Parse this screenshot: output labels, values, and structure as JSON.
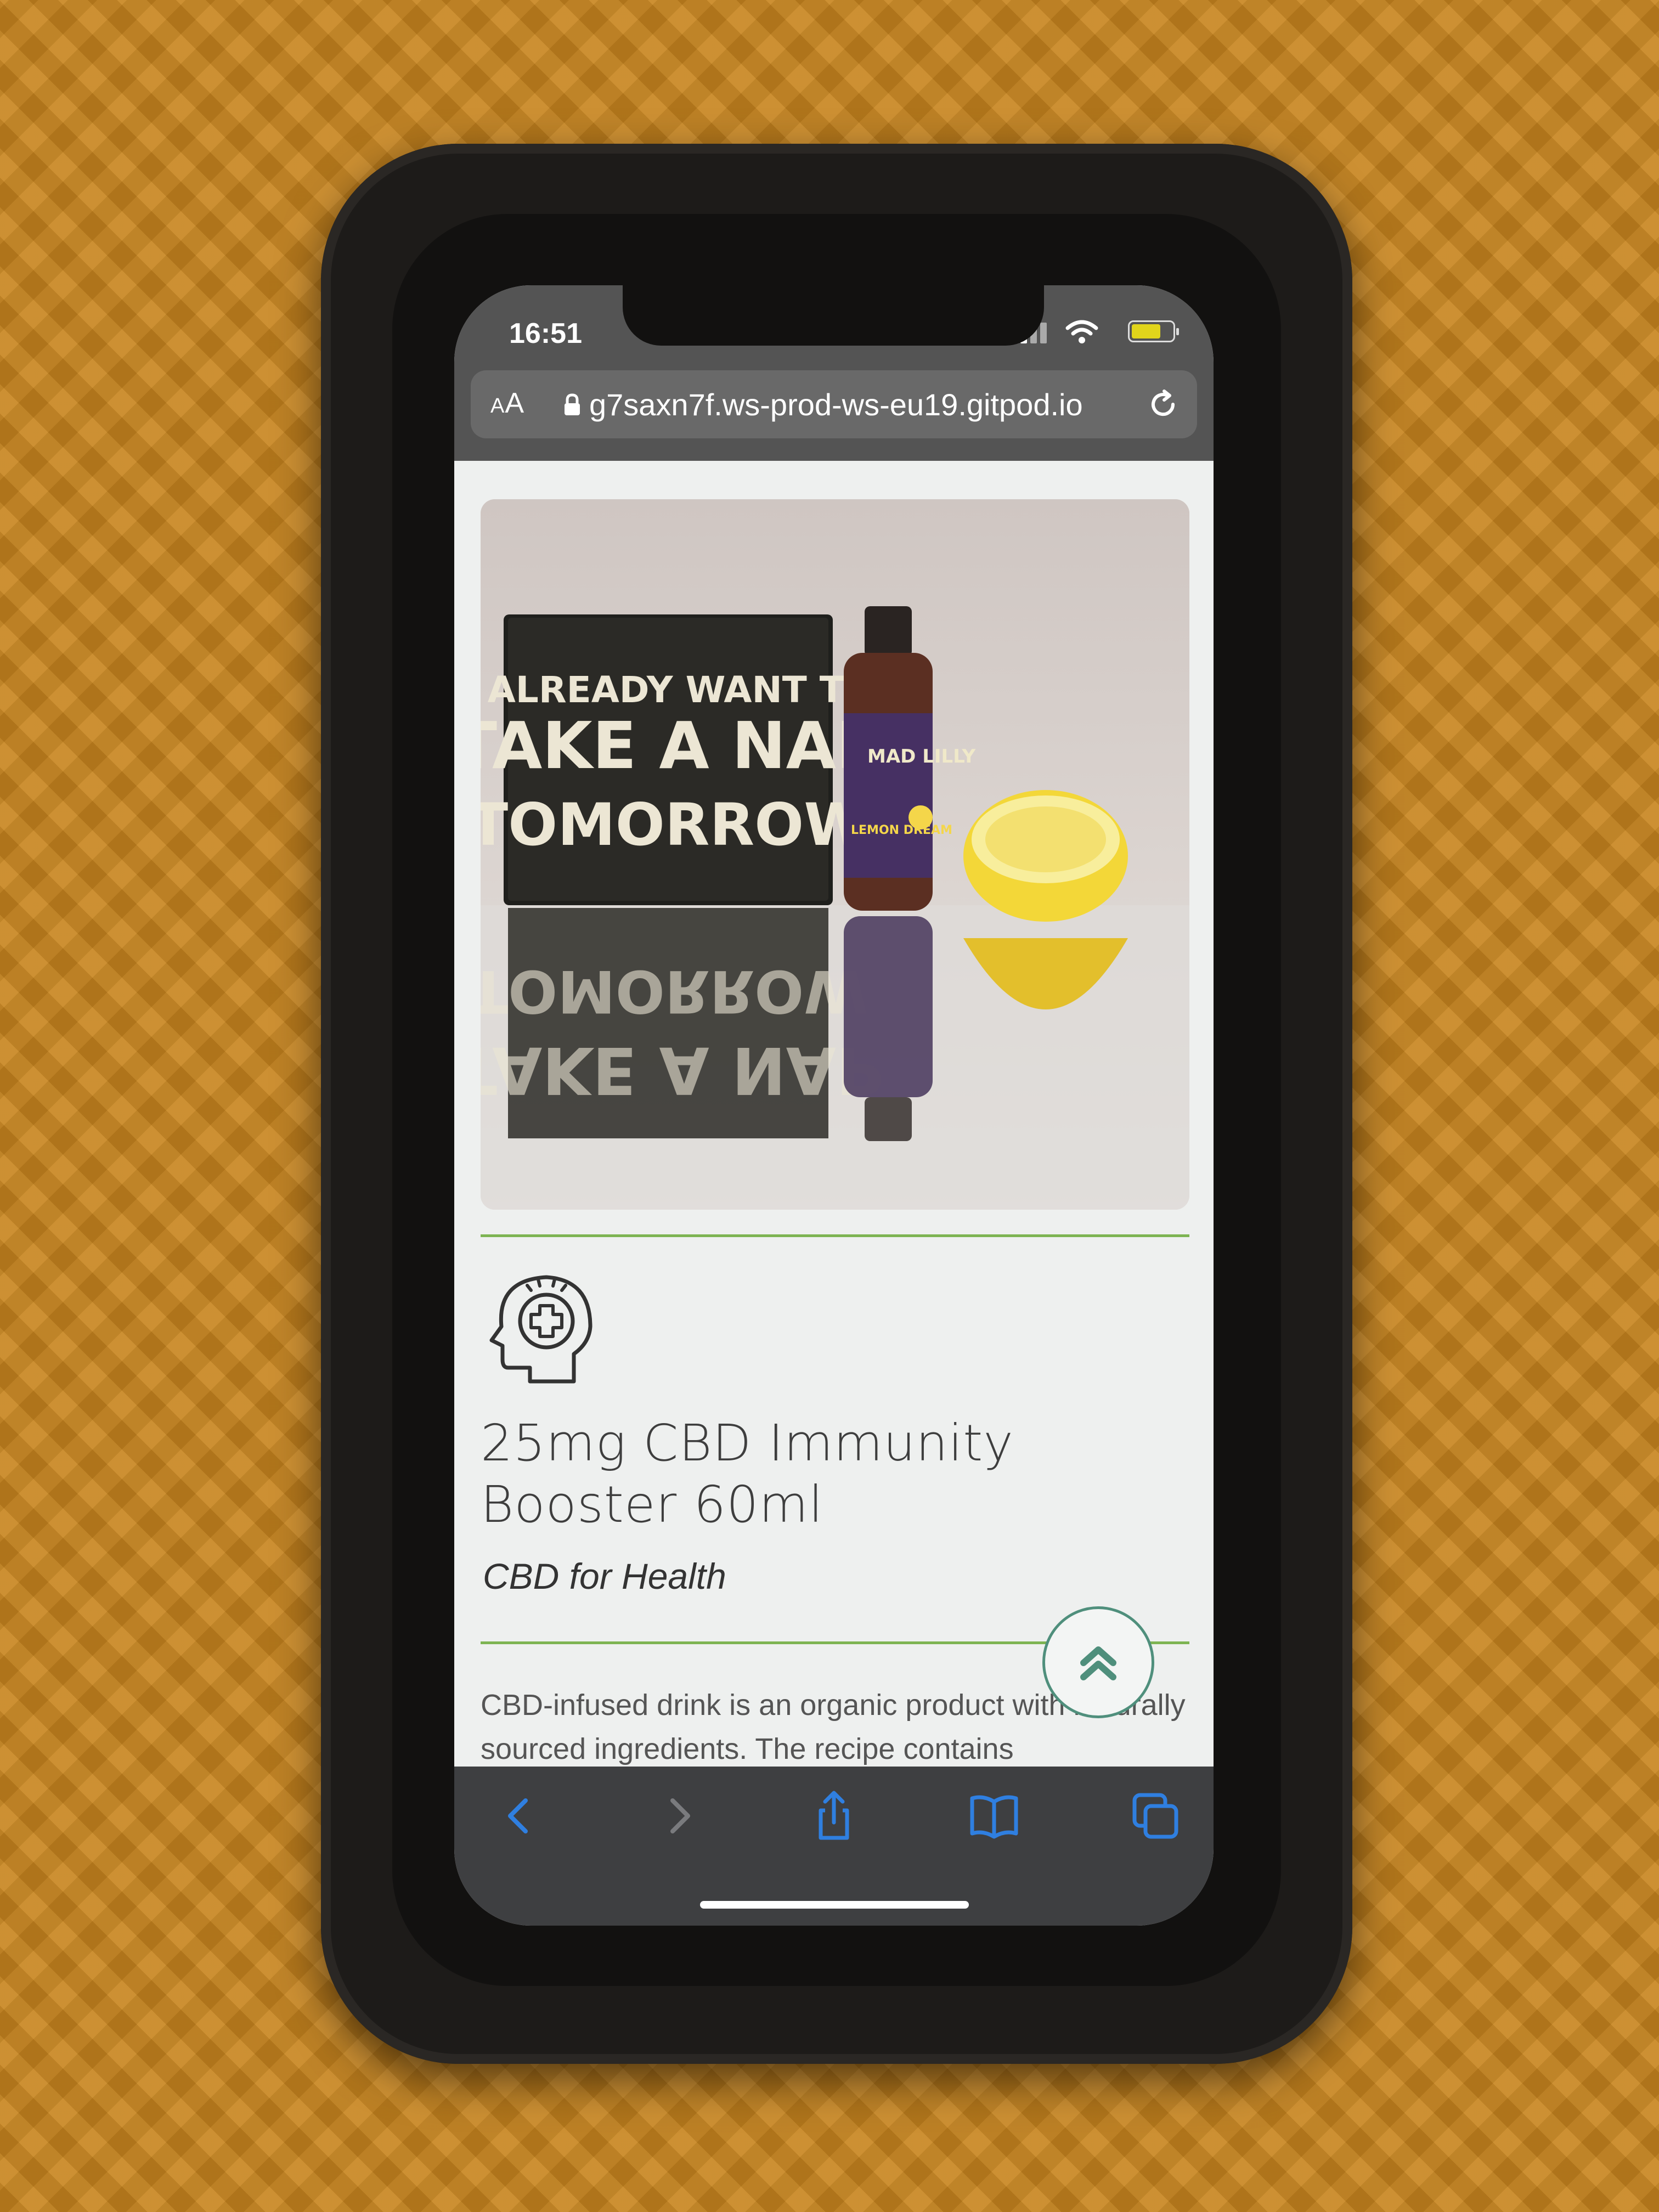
{
  "status_bar": {
    "time": "16:51"
  },
  "browser": {
    "reader_label_small": "A",
    "reader_label_large": "A",
    "url": "g7saxn7f.ws-prod-ws-eu19.gitpod.io"
  },
  "product": {
    "image_sign_text": [
      "I ALREADY WANT TO",
      "TAKE A NAP",
      "TOMORROW"
    ],
    "bottle_brand": "MAD LILLY",
    "bottle_flavor": "LEMON DREAM",
    "title": "25mg CBD Immunity Booster 60ml",
    "category": "CBD for Health",
    "description": "CBD-infused drink is an organic product with naturally sourced ingredients. The recipe contains",
    "category_icon": "head-medical-cross-icon"
  },
  "colors": {
    "accent_green": "#7db452",
    "back_to_top_teal": "#4f8f7c",
    "toolbar_blue": "#2f7fe0"
  }
}
